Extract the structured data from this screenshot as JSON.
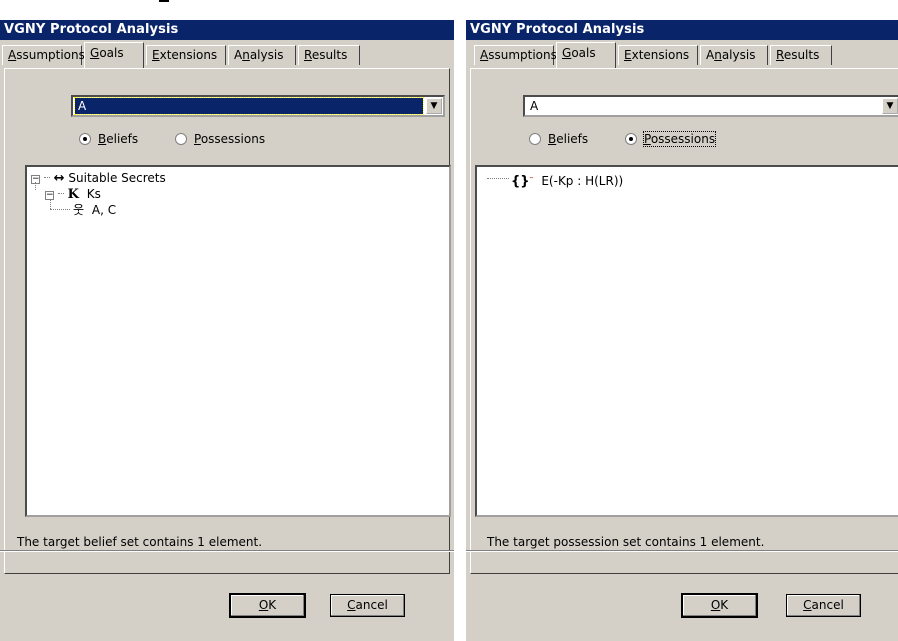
{
  "left": {
    "title": "VGNY Protocol Analysis",
    "tabs": [
      {
        "prefix": "",
        "accel": "A",
        "rest": "ssumptions"
      },
      {
        "prefix": "",
        "accel": "G",
        "rest": "oals"
      },
      {
        "prefix": "",
        "accel": "E",
        "rest": "xtensions"
      },
      {
        "prefix": "A",
        "accel": "n",
        "rest": "alysis"
      },
      {
        "prefix": "",
        "accel": "R",
        "rest": "esults"
      }
    ],
    "active_tab": "Goals",
    "principal": "A",
    "radio_beliefs": {
      "accel": "B",
      "rest": "eliefs",
      "checked": true
    },
    "radio_possessions": {
      "accel": "P",
      "rest": "ossessions",
      "checked": false
    },
    "tree": [
      {
        "icon": "↔",
        "label": "Suitable Secrets"
      },
      {
        "icon": "K",
        "label": "Ks"
      },
      {
        "icon": "웃",
        "label": "A, C"
      }
    ],
    "status": "The target belief set contains 1 element.",
    "ok": {
      "accel": "O",
      "rest": "K"
    },
    "cancel": {
      "accel": "C",
      "rest": "ancel"
    }
  },
  "right": {
    "title": "VGNY Protocol Analysis",
    "tabs": [
      {
        "prefix": "",
        "accel": "A",
        "rest": "ssumptions"
      },
      {
        "prefix": "",
        "accel": "G",
        "rest": "oals"
      },
      {
        "prefix": "",
        "accel": "E",
        "rest": "xtensions"
      },
      {
        "prefix": "A",
        "accel": "n",
        "rest": "alysis"
      },
      {
        "prefix": "",
        "accel": "R",
        "rest": "esults"
      }
    ],
    "active_tab": "Goals",
    "principal": "A",
    "radio_beliefs": {
      "accel": "B",
      "rest": "eliefs",
      "checked": false
    },
    "radio_possessions": {
      "accel": "P",
      "rest": "ossessions",
      "checked": true
    },
    "tree": [
      {
        "icon": "{}",
        "label": "E(-Kp : H(LR))"
      }
    ],
    "status": "The target possession set contains 1 element.",
    "ok": {
      "accel": "O",
      "rest": "K"
    },
    "cancel": {
      "accel": "C",
      "rest": "ancel"
    }
  }
}
